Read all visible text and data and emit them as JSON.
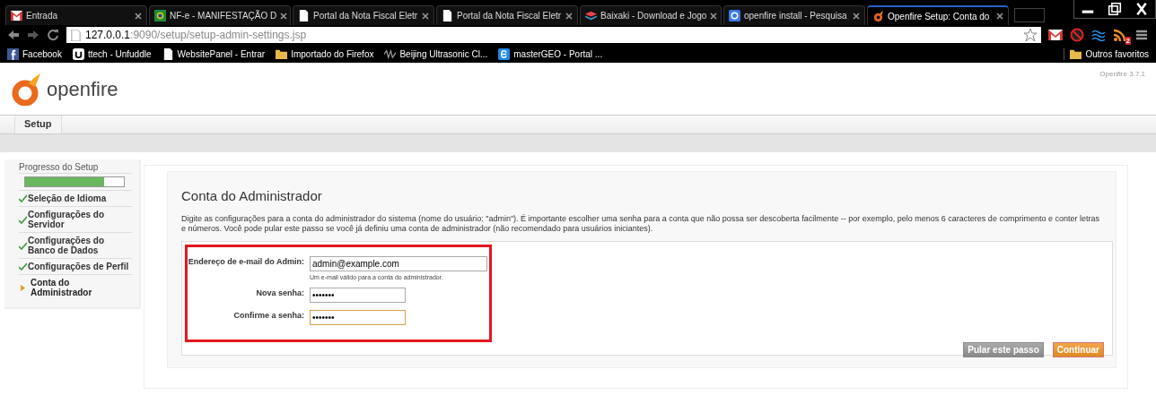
{
  "browser": {
    "tabs": [
      {
        "title": "Entrada",
        "selected": false
      },
      {
        "title": "NF-e - MANIFESTAÇÃO D",
        "selected": false
      },
      {
        "title": "Portal da Nota Fiscal Eletr",
        "selected": false
      },
      {
        "title": "Portal da Nota Fiscal Eletr",
        "selected": false
      },
      {
        "title": "Baixaki - Download e Jogo",
        "selected": false
      },
      {
        "title": "openfire install - Pesquisa",
        "selected": false
      },
      {
        "title": "Openfire Setup: Conta do",
        "selected": true
      }
    ],
    "address": {
      "host": "127.0.0.1",
      "rest": ":9090/setup/setup-admin-settings.jsp"
    },
    "bookmarks": [
      {
        "label": "Facebook"
      },
      {
        "label": "ttech - Unfuddle"
      },
      {
        "label": "WebsitePanel - Entrar"
      },
      {
        "label": "Importado do Firefox"
      },
      {
        "label": "Beijing Ultrasonic Cl..."
      },
      {
        "label": "masterGEO - Portal ..."
      }
    ],
    "other_bookmarks": "Outros favoritos",
    "feed_count": "2"
  },
  "header": {
    "logo": "openfire",
    "version": "Openfire 3.7.1"
  },
  "nav": {
    "tabs": [
      {
        "label": "Setup",
        "selected": true
      }
    ]
  },
  "sidebar": {
    "title": "Progresso do Setup",
    "level": 0.8,
    "items": [
      {
        "label": "Seleção de Idioma",
        "done": true,
        "selected": false
      },
      {
        "label": "Configurações do Servidor",
        "done": true,
        "selected": false
      },
      {
        "label": "Configurações do Banco de Dados",
        "done": true,
        "selected": false
      },
      {
        "label": "Configurações de Perfil",
        "done": true,
        "selected": false
      },
      {
        "label": "Conta do Administrador",
        "done": false,
        "selected": true
      }
    ]
  },
  "main": {
    "title": "Conta do Administrador",
    "description": "Digite as configurações para a conta do administrador do sistema (nome do usuário: \"admin\"). É importante escolher uma senha para a conta que não possa ser descoberta facilmente -- por exemplo, pelo menos 6 caracteres de comprimento e conter letras e números. Você pode pular este passo se você já definiu uma conta de administrador (não recomendado para usuários iniciantes).",
    "fields": [
      {
        "label": "Endereço de e-mail do Admin:",
        "value": "admin@example.com",
        "hint": "Um e-mail válido para a conta do administrador.",
        "focused": false
      },
      {
        "label": "Nova senha:",
        "value": "•••••••",
        "focused": false
      },
      {
        "label": "Confirme a senha:",
        "value": "•••••••",
        "focused": true
      }
    ],
    "buttons": [
      {
        "label": "Pular este passo",
        "kind": "secondary"
      },
      {
        "label": "Continuar",
        "kind": "primary"
      }
    ]
  }
}
